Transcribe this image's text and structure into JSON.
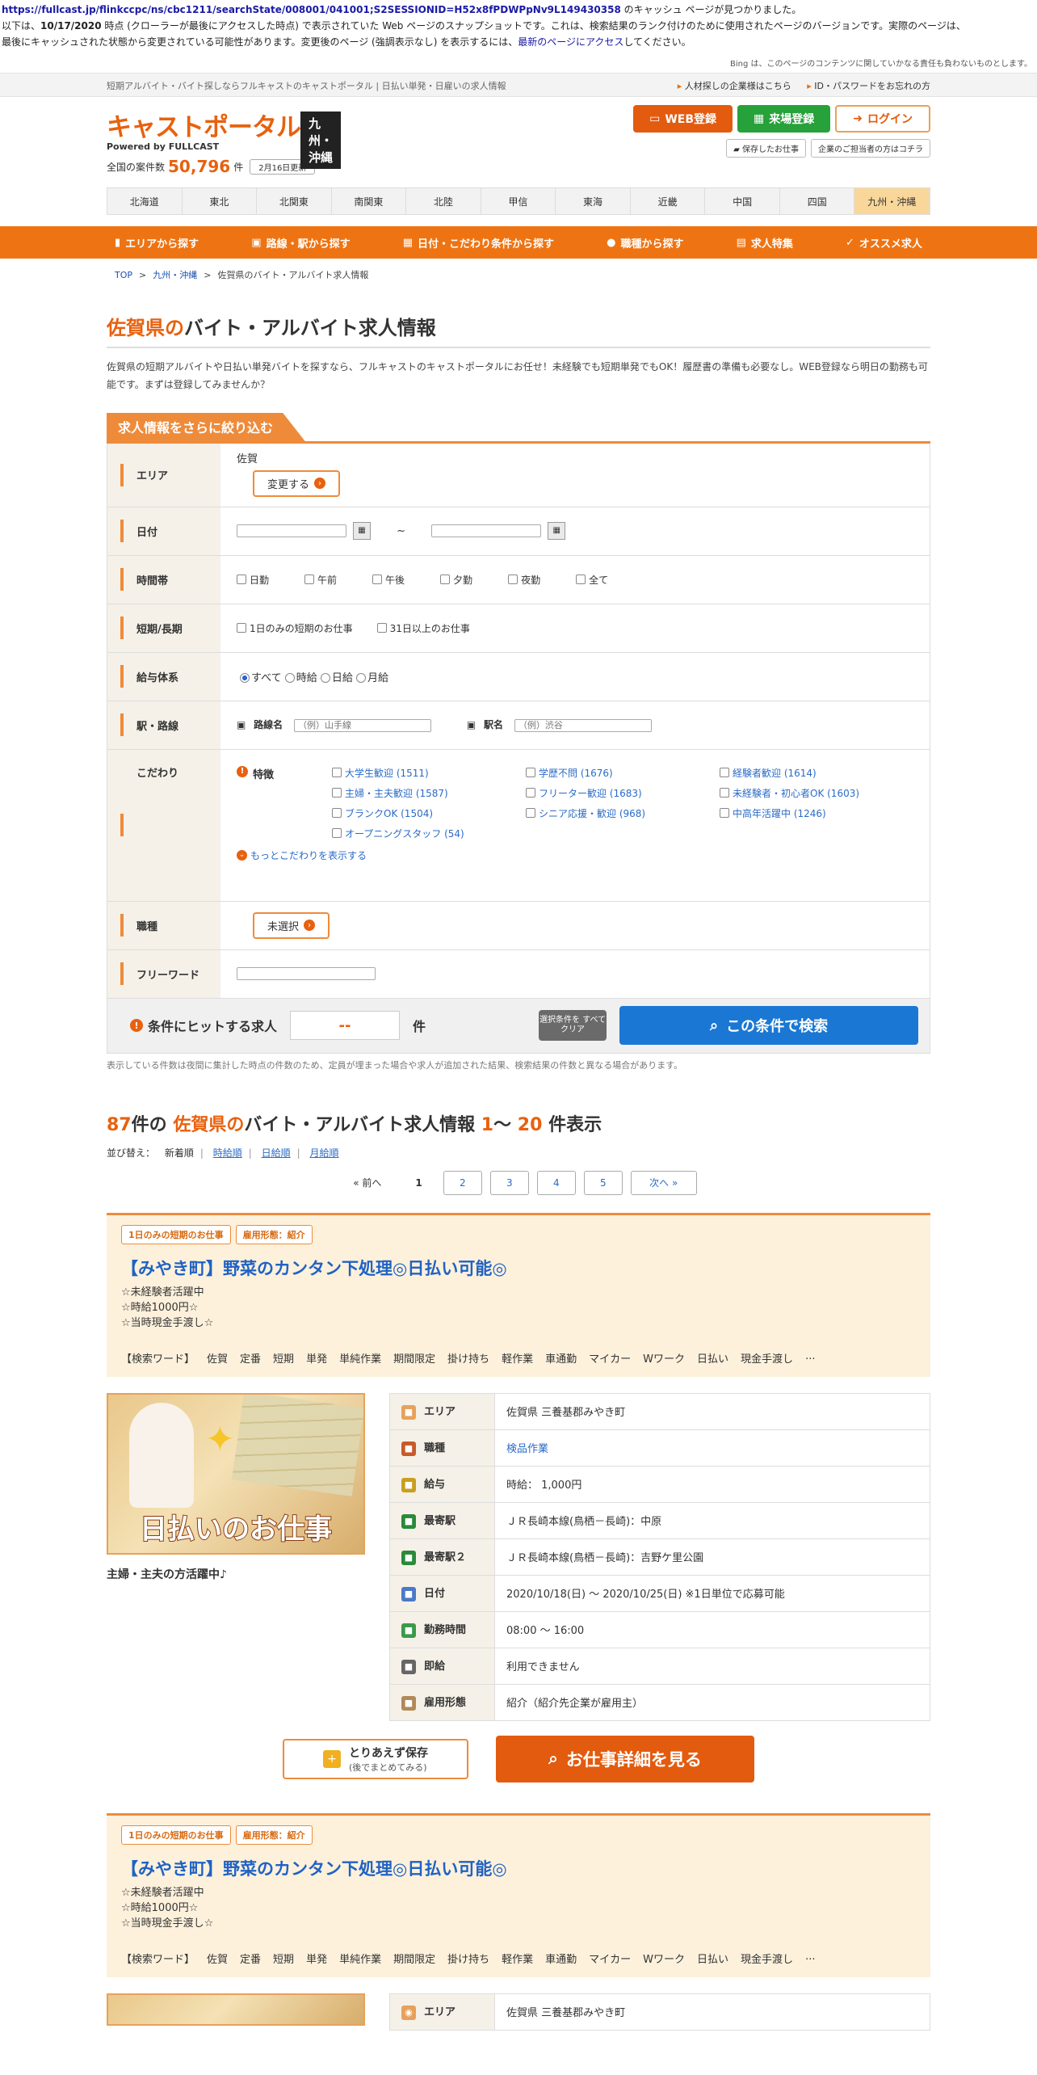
{
  "cache": {
    "url": "https://fullcast.jp/flinkccpc/ns/cbc1211/searchState/008001/041001;S2SESSIONID=H52x8fPDWPpNv9L149430358",
    "url_suffix": " のキャッシュ ページが見つかりました。",
    "line2_a": "以下は、",
    "line2_date": "10/17/2020",
    "line2_b": " 時点 (クローラーが最後にアクセスした時点) で表示されていた Web ページのスナップショットです。これは、検索結果のランク付けのために使用されたページのバージョンです。実際のページは、",
    "line3_a": "最後にキャッシュされた状態から変更されている可能性があります。変更後のページ (強調表示なし) を表示するには、",
    "line3_link": "最新のページにアクセス",
    "line3_b": "してください。",
    "bing_note": "Bing は、このページのコンテンツに関していかなる責任も負わないものとします。"
  },
  "topbar": {
    "tagline": "短期アルバイト・バイト探しならフルキャストのキャストポータル | 日払い単発・日雇いの求人情報",
    "link1": "人材探しの企業様はこちら",
    "link2": "ID・パスワードをお忘れの方"
  },
  "header": {
    "brand": "キャストポータル",
    "region": "九州・沖縄",
    "powered": "Powered by FULLCAST",
    "count_label": "全国の案件数",
    "count": "50,796",
    "count_unit": "件",
    "updated": "2月16日更新",
    "btn_web": "WEB登録",
    "btn_come": "来場登録",
    "btn_login": "ログイン",
    "saved_jobs": "保存したお仕事",
    "corp_link": "企業のご担当者の方はコチラ"
  },
  "regions": [
    "北海道",
    "東北",
    "北関東",
    "南関東",
    "北陸",
    "甲信",
    "東海",
    "近畿",
    "中国",
    "四国",
    "九州・沖縄"
  ],
  "nav": [
    "エリアから探す",
    "路線・駅から探す",
    "日付・こだわり条件から探す",
    "職種から探す",
    "求人特集",
    "オススメ求人"
  ],
  "breadcrumb": {
    "top": "TOP",
    "region": "九州・沖縄",
    "current": "佐賀県のバイト・アルバイト求人情報"
  },
  "page": {
    "title_pref": "佐賀県の",
    "title_rest": "バイト・アルバイト求人情報",
    "intro": "佐賀県の短期アルバイトや日払い単発バイトを探すなら、フルキャストのキャストポータルにお任せ！未経験でも短期単発でもOK！履歴書の準備も必要なし。WEB登録なら明日の勤務も可能です。まずは登録してみませんか？"
  },
  "filter": {
    "heading": "求人情報をさらに絞り込む",
    "area_label": "エリア",
    "area_value": "佐賀",
    "area_change": "変更する",
    "date_label": "日付",
    "date_sep": "~",
    "time_label": "時間帯",
    "time_opts": [
      "日勤",
      "午前",
      "午後",
      "夕勤",
      "夜勤",
      "全て"
    ],
    "term_label": "短期/長期",
    "term_opts": [
      "1日のみの短期のお仕事",
      "31日以上のお仕事"
    ],
    "pay_label": "給与体系",
    "pay_opts": [
      "すべて",
      "時給",
      "日給",
      "月給"
    ],
    "station_label": "駅・路線",
    "line_label": "路線名",
    "line_ph": "（例）山手線",
    "station_name_label": "駅名",
    "station_ph": "（例）渋谷",
    "kodawari_label": "こだわり",
    "feature_label": "特徴",
    "features": [
      "大学生歓迎 (1511)",
      "学歴不問 (1676)",
      "経験者歓迎 (1614)",
      "主婦・主夫歓迎 (1587)",
      "フリーター歓迎 (1683)",
      "未経験者・初心者OK (1603)",
      "ブランクOK (1504)",
      "シニア応援・歓迎 (968)",
      "中高年活躍中 (1246)",
      "オープニングスタッフ (54)"
    ],
    "more": "もっとこだわりを表示する",
    "job_label": "職種",
    "job_value": "未選択",
    "free_label": "フリーワード",
    "hit_label": "条件にヒットする求人",
    "hit_count": "--",
    "hit_unit": "件",
    "clear": "選択条件を すべてクリア",
    "search": "この条件で検索",
    "note": "表示している件数は夜間に集計した時点の件数のため、定員が埋まった場合や求人が追加された結果、検索結果の件数と異なる場合があります。"
  },
  "results": {
    "count": "87",
    "count_suffix": "件の",
    "pref": "佐賀県の",
    "rest": "バイト・アルバイト求人情報",
    "from": "1",
    "range_sep": "～",
    "to": "20",
    "range_suffix": "件表示",
    "sort_label": "並び替え：",
    "sort_current": "新着順",
    "sort_opts": [
      "時給順",
      "日給順",
      "月給順"
    ],
    "pager": {
      "prev": "« 前へ",
      "current": "1",
      "pages": [
        "2",
        "3",
        "4",
        "5"
      ],
      "next": "次へ »"
    }
  },
  "jobs": [
    {
      "tag1": "1日のみの短期のお仕事",
      "tag2": "雇用形態：紹介",
      "title": "【みやき町】野菜のカンタン下処理◎日払い可能◎",
      "desc1": "☆未経験者活躍中",
      "desc2": "☆時給1000円☆",
      "desc3": "☆当時現金手渡し☆",
      "keywords": [
        "【検索ワード】",
        "佐賀",
        "定番",
        "短期",
        "単発",
        "単純作業",
        "期間限定",
        "掛け持ち",
        "軽作業",
        "車通勤",
        "マイカー",
        "Wワーク",
        "日払い",
        "現金手渡し",
        "..."
      ],
      "image_text": "日払いのお仕事",
      "caption": "主婦・主夫の方活躍中♪",
      "rows": [
        {
          "k": "エリア",
          "v": "佐賀県 三養基郡みやき町",
          "icon": "map-pin-icon",
          "color": "#e8a15a"
        },
        {
          "k": "職種",
          "v": "検品作業",
          "icon": "worker-icon",
          "color": "#c85a2a",
          "link": true
        },
        {
          "k": "給与",
          "v": "時給： 1,000円",
          "icon": "money-bag-icon",
          "color": "#c8a020"
        },
        {
          "k": "最寄駅",
          "v": "ＪＲ長崎本線(鳥栖－長崎)：中原",
          "icon": "train-icon",
          "color": "#2a8a3a"
        },
        {
          "k": "最寄駅２",
          "v": "ＪＲ長崎本線(鳥栖－長崎)：吉野ケ里公園",
          "icon": "train-icon",
          "color": "#2a8a3a"
        },
        {
          "k": "日付",
          "v": "2020/10/18(日) ～ 2020/10/25(日) ※1日単位で応募可能",
          "icon": "calendar-icon",
          "color": "#4a7ac8"
        },
        {
          "k": "勤務時間",
          "v": "08:00 ～ 16:00",
          "icon": "clock-icon",
          "color": "#3a9a4a"
        },
        {
          "k": "即給",
          "v": "利用できません",
          "icon": "calculator-icon",
          "color": "#666666"
        },
        {
          "k": "雇用形態",
          "v": "紹介（紹介先企業が雇用主）",
          "icon": "document-icon",
          "color": "#b08a5a"
        }
      ],
      "save_l1": "とりあえず保存",
      "save_l2": "(後でまとめてみる)",
      "detail": "お仕事詳細を見る"
    },
    {
      "tag1": "1日のみの短期のお仕事",
      "tag2": "雇用形態：紹介",
      "title": "【みやき町】野菜のカンタン下処理◎日払い可能◎",
      "desc1": "☆未経験者活躍中",
      "desc2": "☆時給1000円☆",
      "desc3": "☆当時現金手渡し☆",
      "keywords": [
        "【検索ワード】",
        "佐賀",
        "定番",
        "短期",
        "単発",
        "単純作業",
        "期間限定",
        "掛け持ち",
        "軽作業",
        "車通勤",
        "マイカー",
        "Wワーク",
        "日払い",
        "現金手渡し",
        "..."
      ],
      "row1_k": "エリア",
      "row1_v": "佐賀県 三養基郡みやき町"
    }
  ]
}
